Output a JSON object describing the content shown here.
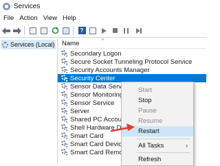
{
  "window": {
    "title": "Services"
  },
  "menubar": {
    "items": [
      "File",
      "Action",
      "View",
      "Help"
    ]
  },
  "toolbar": {
    "icons": [
      "back-icon",
      "forward-icon",
      "show-hide-tree-icon",
      "properties-icon",
      "refresh-icon",
      "export-list-icon",
      "help-icon",
      "pane-toggle-icon",
      "start-service-icon",
      "stop-service-icon",
      "pause-service-icon",
      "restart-service-icon"
    ],
    "help_glyph": "?"
  },
  "tree": {
    "items": [
      {
        "label": "Services (Local)",
        "selected": true
      }
    ]
  },
  "list": {
    "column_name": "Name",
    "sort_arrow": "^",
    "rows": [
      "Secondary Logon",
      "Secure Socket Tunneling Protocol Service",
      "Security Accounts Manager",
      "Security Center",
      "Sensor Data Service",
      "Sensor Monitoring Service",
      "Sensor Service",
      "Server",
      "Shared PC Account Manager",
      "Shell Hardware Detection",
      "Smart Card",
      "Smart Card Device Enumeration Service",
      "Smart Card Removal Policy"
    ],
    "selected_row": "Security Center"
  },
  "context_menu": {
    "items": [
      {
        "label": "Start",
        "enabled": false
      },
      {
        "label": "Stop",
        "enabled": true
      },
      {
        "label": "Pause",
        "enabled": false
      },
      {
        "label": "Resume",
        "enabled": false
      },
      {
        "label": "Restart",
        "enabled": true,
        "highlighted": true
      },
      {
        "label": "All Tasks",
        "enabled": true,
        "submenu_arrow": "›"
      },
      {
        "label": "Refresh",
        "enabled": true
      }
    ]
  },
  "colors": {
    "selection": "#0078d7",
    "menu_highlight": "#cde6f7",
    "annotation_arrow": "#e53935"
  }
}
